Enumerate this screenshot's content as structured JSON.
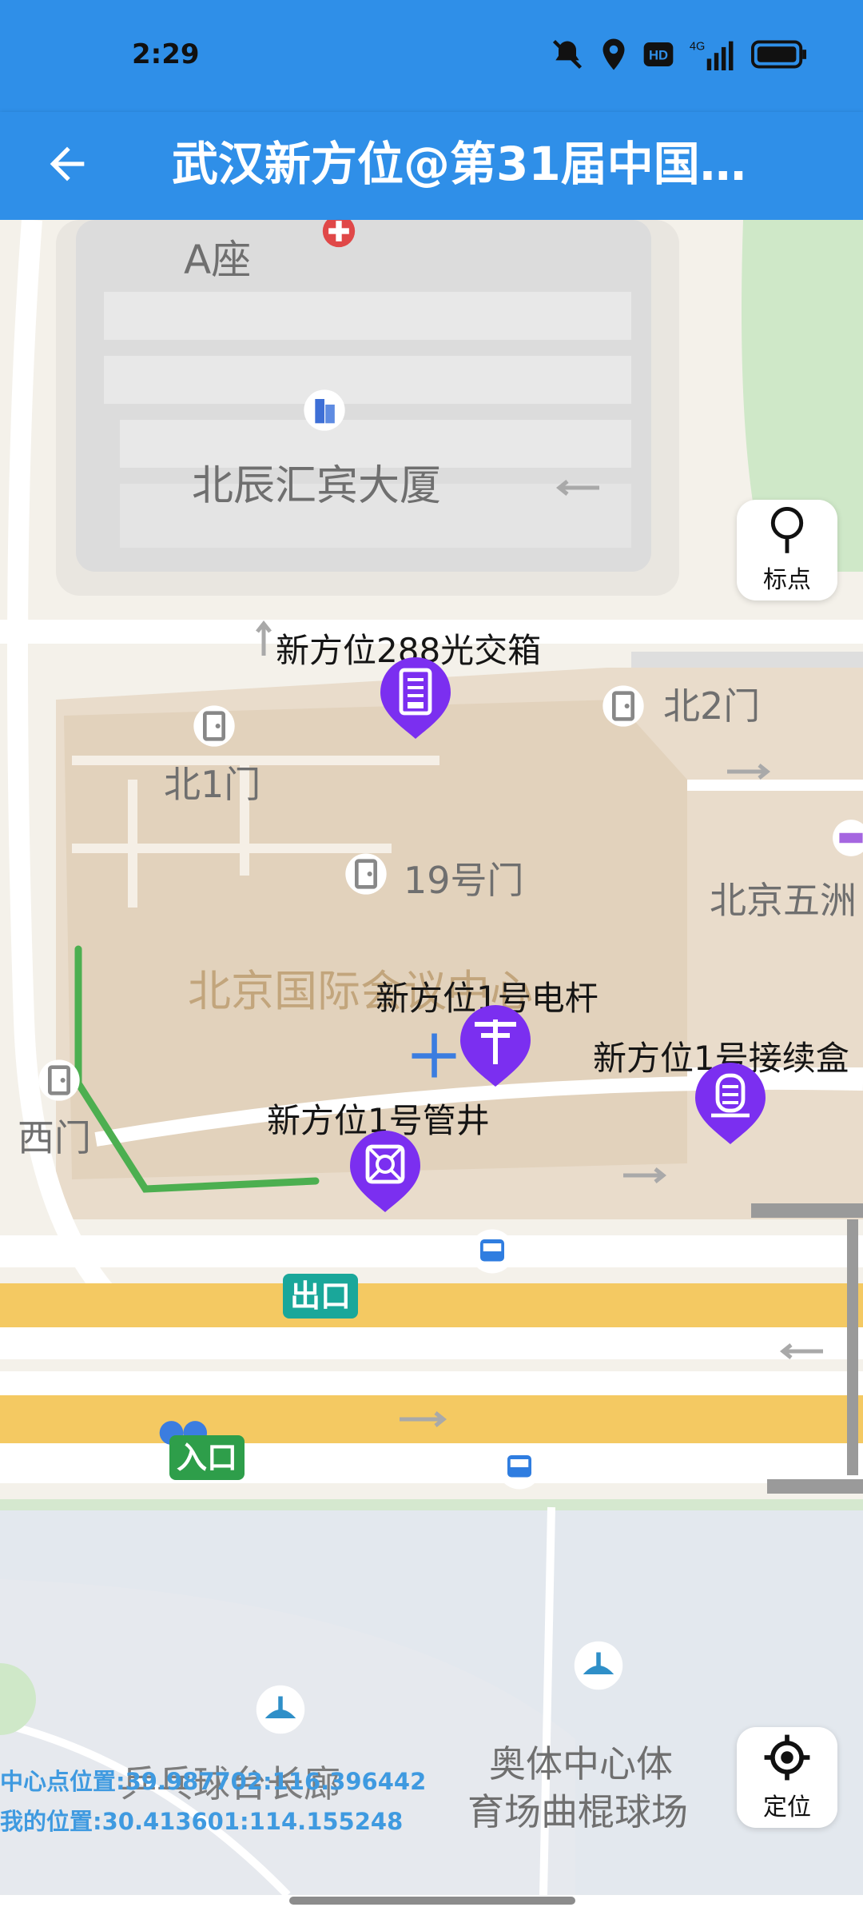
{
  "status": {
    "time": "2:29"
  },
  "appbar": {
    "title": "武汉新方位@第31届中国…"
  },
  "map": {
    "labels": {
      "a_building": "A座",
      "beichen": "北辰汇宾大厦",
      "north1": "北1门",
      "north2": "北2门",
      "gate19": "19号门",
      "beijing_five": "北京五洲",
      "conference": "北京国际会议中心",
      "west": "西门",
      "exit": "出口",
      "entrance": "入口",
      "pingpong": "乒乓球台长廊",
      "olympic": "奥体中心体",
      "hockey": "育场曲棍球场"
    },
    "pois": [
      {
        "label": "新方位288光交箱",
        "icon": "fiber-box-icon"
      },
      {
        "label": "新方位1号电杆",
        "icon": "pole-icon"
      },
      {
        "label": "新方位1号接续盒",
        "icon": "splice-box-icon"
      },
      {
        "label": "新方位1号管井",
        "icon": "manhole-icon"
      }
    ]
  },
  "controls": {
    "mark_label": "标点",
    "locate_label": "定位"
  },
  "info": {
    "center": "中心点位置:39.987702:116.396442",
    "mine": "我的位置:30.413601:114.155248"
  },
  "colors": {
    "accent": "#2f8fe8",
    "poi": "#7b2ff0",
    "route": "#4caf50"
  }
}
